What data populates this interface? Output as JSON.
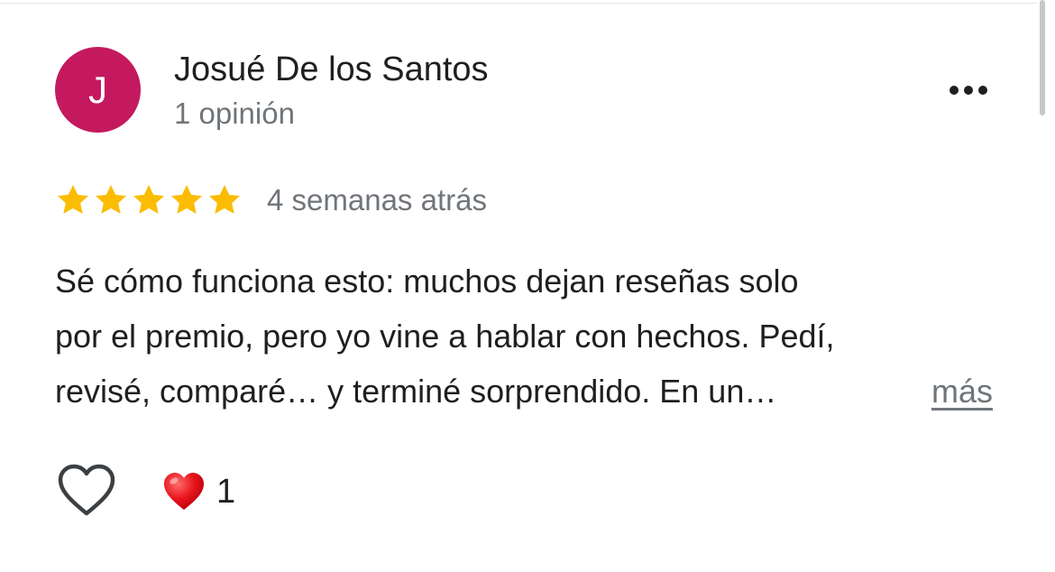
{
  "review": {
    "author": {
      "initial": "J",
      "name": "Josué De los Santos",
      "meta": "1 opinión",
      "avatar_color": "#c4195f"
    },
    "rating": {
      "value": 5,
      "max": 5,
      "star_color": "#fbbc04"
    },
    "timestamp": "4 semanas atrás",
    "text_lines": [
      "Sé cómo funciona esto: muchos dejan reseñas solo",
      "por el premio, pero yo vine a hablar con hechos. Pedí,",
      "revisé, comparé… y terminé sorprendido. En un…"
    ],
    "more_label": "más",
    "reaction": {
      "icon": "red-heart-emoji",
      "count": "1"
    },
    "icons": {
      "options": "more-horizontal-icon",
      "like": "heart-outline-icon"
    }
  }
}
